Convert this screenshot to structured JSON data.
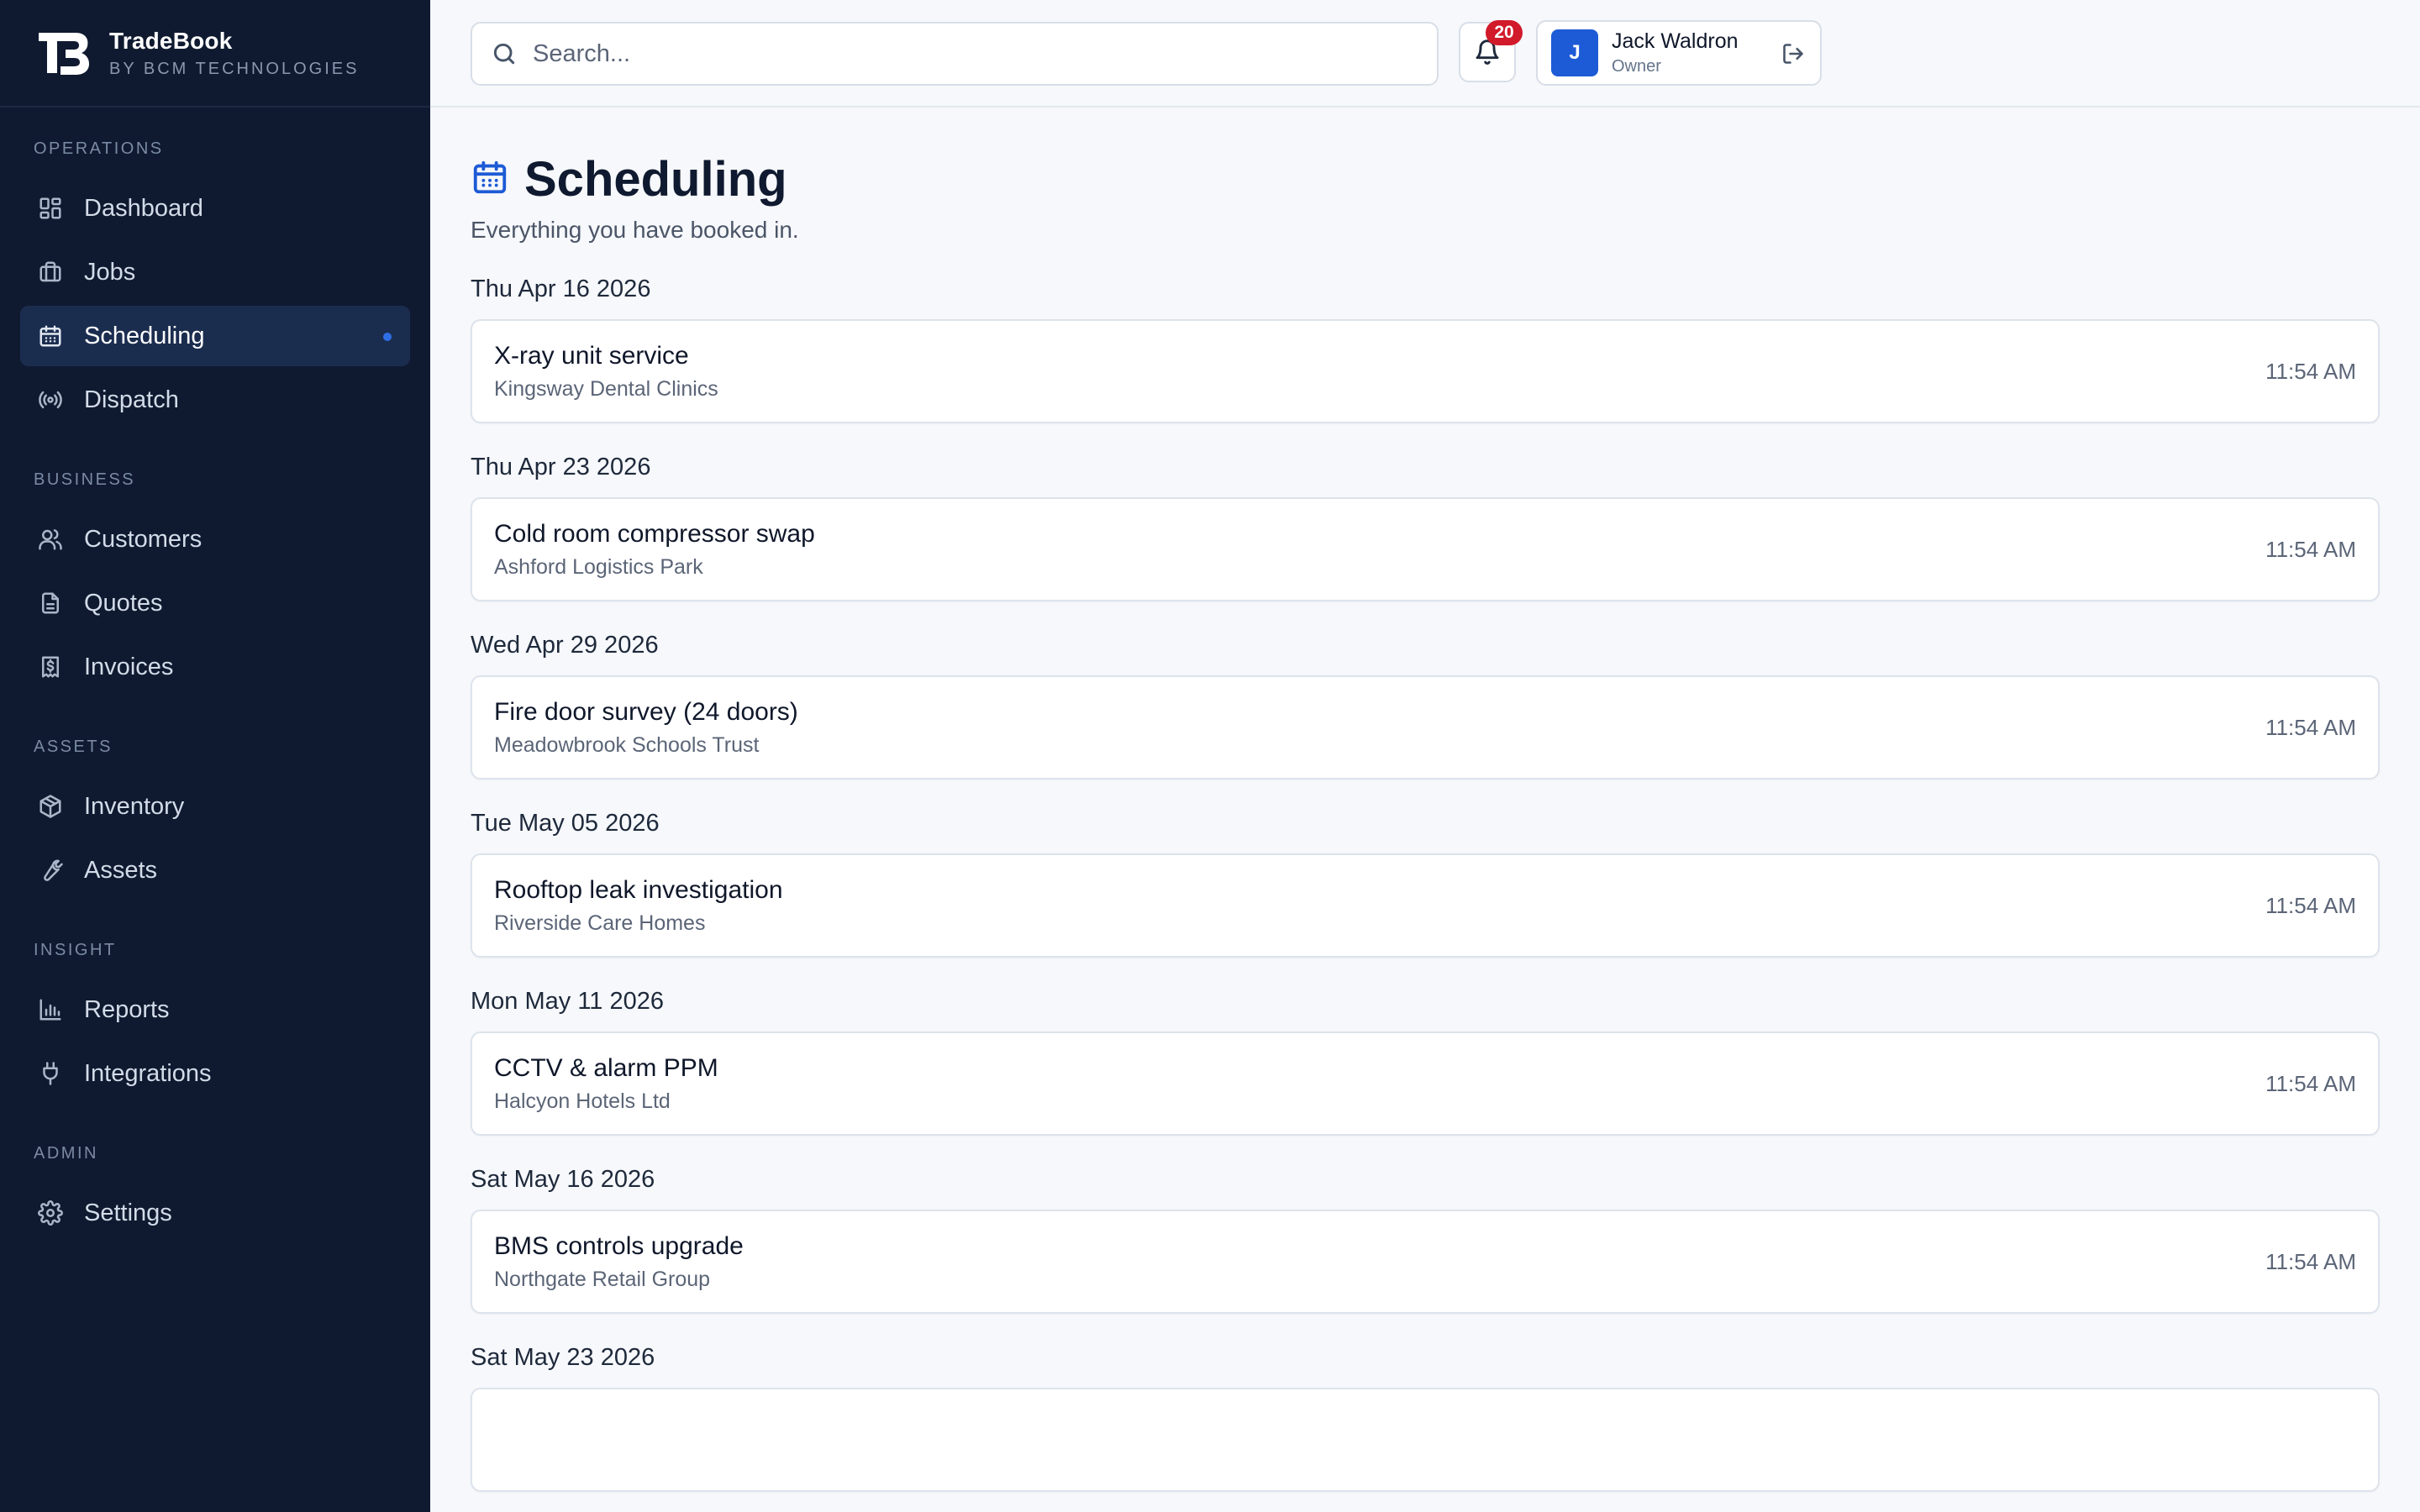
{
  "brand": {
    "name": "TradeBook",
    "sub": "BY BCM TECHNOLOGIES"
  },
  "sidebar": {
    "sections": [
      {
        "label": "OPERATIONS",
        "items": [
          {
            "label": "Dashboard",
            "icon": "dashboard-icon"
          },
          {
            "label": "Jobs",
            "icon": "briefcase-icon"
          },
          {
            "label": "Scheduling",
            "icon": "calendar-icon",
            "active": true
          },
          {
            "label": "Dispatch",
            "icon": "broadcast-icon"
          }
        ]
      },
      {
        "label": "BUSINESS",
        "items": [
          {
            "label": "Customers",
            "icon": "users-icon"
          },
          {
            "label": "Quotes",
            "icon": "document-icon"
          },
          {
            "label": "Invoices",
            "icon": "invoice-icon"
          }
        ]
      },
      {
        "label": "ASSETS",
        "items": [
          {
            "label": "Inventory",
            "icon": "box-icon"
          },
          {
            "label": "Assets",
            "icon": "wrench-icon"
          }
        ]
      },
      {
        "label": "INSIGHT",
        "items": [
          {
            "label": "Reports",
            "icon": "bar-chart-icon"
          },
          {
            "label": "Integrations",
            "icon": "plug-icon"
          }
        ]
      },
      {
        "label": "ADMIN",
        "items": [
          {
            "label": "Settings",
            "icon": "gear-icon"
          }
        ]
      }
    ]
  },
  "topbar": {
    "search_placeholder": "Search...",
    "notifications_count": "20",
    "user": {
      "initial": "J",
      "name": "Jack Waldron",
      "role": "Owner"
    }
  },
  "page": {
    "title": "Scheduling",
    "subtitle": "Everything you have booked in."
  },
  "schedule": [
    {
      "date": "Thu Apr 16 2026",
      "job": "X-ray unit service",
      "client": "Kingsway Dental Clinics",
      "time": "11:54 AM"
    },
    {
      "date": "Thu Apr 23 2026",
      "job": "Cold room compressor swap",
      "client": "Ashford Logistics Park",
      "time": "11:54 AM"
    },
    {
      "date": "Wed Apr 29 2026",
      "job": "Fire door survey (24 doors)",
      "client": "Meadowbrook Schools Trust",
      "time": "11:54 AM"
    },
    {
      "date": "Tue May 05 2026",
      "job": "Rooftop leak investigation",
      "client": "Riverside Care Homes",
      "time": "11:54 AM"
    },
    {
      "date": "Mon May 11 2026",
      "job": "CCTV & alarm PPM",
      "client": "Halcyon Hotels Ltd",
      "time": "11:54 AM"
    },
    {
      "date": "Sat May 16 2026",
      "job": "BMS controls upgrade",
      "client": "Northgate Retail Group",
      "time": "11:54 AM"
    },
    {
      "date": "Sat May 23 2026",
      "job": "",
      "client": "",
      "time": ""
    }
  ],
  "colors": {
    "sidebar_bg": "#0f1a30",
    "accent": "#1d5bd6",
    "badge": "#d11a2a",
    "active_item_bg": "#1b2d4f"
  }
}
